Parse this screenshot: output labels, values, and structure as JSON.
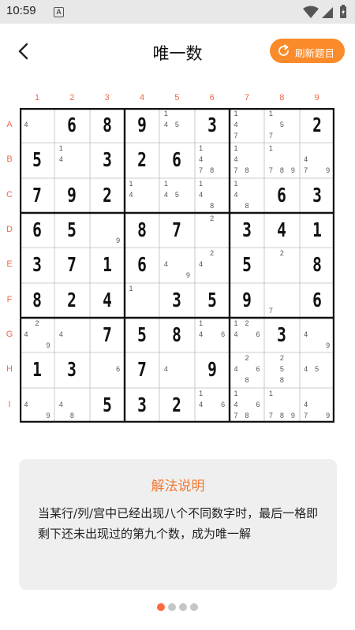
{
  "status": {
    "time": "10:59",
    "notification_icon": "A"
  },
  "header": {
    "title": "唯一数",
    "refresh_label": "刷新题目"
  },
  "board": {
    "col_labels": [
      "1",
      "2",
      "3",
      "4",
      "5",
      "6",
      "7",
      "8",
      "9"
    ],
    "row_labels": [
      "A",
      "B",
      "C",
      "D",
      "E",
      "F",
      "G",
      "H",
      "I"
    ],
    "cells": [
      [
        {
          "c": [
            4
          ]
        },
        {
          "v": "6"
        },
        {
          "v": "8"
        },
        {
          "v": "9"
        },
        {
          "c": [
            1,
            4,
            5
          ]
        },
        {
          "v": "3"
        },
        {
          "c": [
            1,
            4,
            7
          ]
        },
        {
          "c": [
            1,
            5,
            7
          ]
        },
        {
          "v": "2"
        }
      ],
      [
        {
          "v": "5"
        },
        {
          "c": [
            1,
            4
          ]
        },
        {
          "v": "3"
        },
        {
          "v": "2"
        },
        {
          "v": "6"
        },
        {
          "c": [
            1,
            4,
            7,
            8
          ]
        },
        {
          "c": [
            1,
            4,
            7,
            8
          ]
        },
        {
          "c": [
            1,
            7,
            8,
            9
          ]
        },
        {
          "c": [
            4,
            7,
            9
          ]
        }
      ],
      [
        {
          "v": "7"
        },
        {
          "v": "9"
        },
        {
          "v": "2"
        },
        {
          "c": [
            1,
            4
          ]
        },
        {
          "c": [
            1,
            4,
            5
          ]
        },
        {
          "c": [
            1,
            4,
            8
          ]
        },
        {
          "c": [
            1,
            4,
            8
          ]
        },
        {
          "v": "6"
        },
        {
          "v": "3"
        }
      ],
      [
        {
          "v": "6"
        },
        {
          "v": "5"
        },
        {
          "c": [
            9
          ]
        },
        {
          "v": "8"
        },
        {
          "v": "7"
        },
        {
          "c": [
            2
          ]
        },
        {
          "v": "3"
        },
        {
          "v": "4"
        },
        {
          "v": "1"
        }
      ],
      [
        {
          "v": "3"
        },
        {
          "v": "7"
        },
        {
          "v": "1"
        },
        {
          "v": "6"
        },
        {
          "c": [
            4,
            9
          ]
        },
        {
          "c": [
            2,
            4
          ]
        },
        {
          "v": "5"
        },
        {
          "c": [
            2
          ]
        },
        {
          "v": "8"
        }
      ],
      [
        {
          "v": "8"
        },
        {
          "v": "2"
        },
        {
          "v": "4"
        },
        {
          "c": [
            1
          ]
        },
        {
          "v": "3"
        },
        {
          "v": "5"
        },
        {
          "v": "9"
        },
        {
          "c": [
            7
          ]
        },
        {
          "v": "6"
        }
      ],
      [
        {
          "c": [
            2,
            4,
            9
          ]
        },
        {
          "c": [
            4
          ]
        },
        {
          "v": "7"
        },
        {
          "v": "5"
        },
        {
          "v": "8"
        },
        {
          "c": [
            1,
            4,
            6
          ]
        },
        {
          "c": [
            1,
            2,
            4,
            6
          ]
        },
        {
          "v": "3"
        },
        {
          "c": [
            4,
            9
          ]
        }
      ],
      [
        {
          "v": "1"
        },
        {
          "v": "3"
        },
        {
          "c": [
            6
          ]
        },
        {
          "v": "7"
        },
        {
          "c": [
            4
          ]
        },
        {
          "v": "9"
        },
        {
          "c": [
            2,
            4,
            6,
            8
          ]
        },
        {
          "c": [
            2,
            5,
            8
          ]
        },
        {
          "c": [
            4,
            5
          ]
        }
      ],
      [
        {
          "c": [
            4,
            9
          ]
        },
        {
          "c": [
            4,
            8
          ]
        },
        {
          "v": "5"
        },
        {
          "v": "3"
        },
        {
          "v": "2"
        },
        {
          "c": [
            1,
            4,
            6
          ]
        },
        {
          "c": [
            1,
            4,
            6,
            7,
            8
          ]
        },
        {
          "c": [
            1,
            7,
            8,
            9
          ]
        },
        {
          "c": [
            4,
            7,
            9
          ]
        }
      ]
    ]
  },
  "explanation": {
    "title": "解法说明",
    "body": "当某行/列/宫中已经出现八个不同数字时，最后一格即剩下还未出现过的第九个数，成为唯一解"
  },
  "pager": {
    "count": 4,
    "active": 1
  }
}
